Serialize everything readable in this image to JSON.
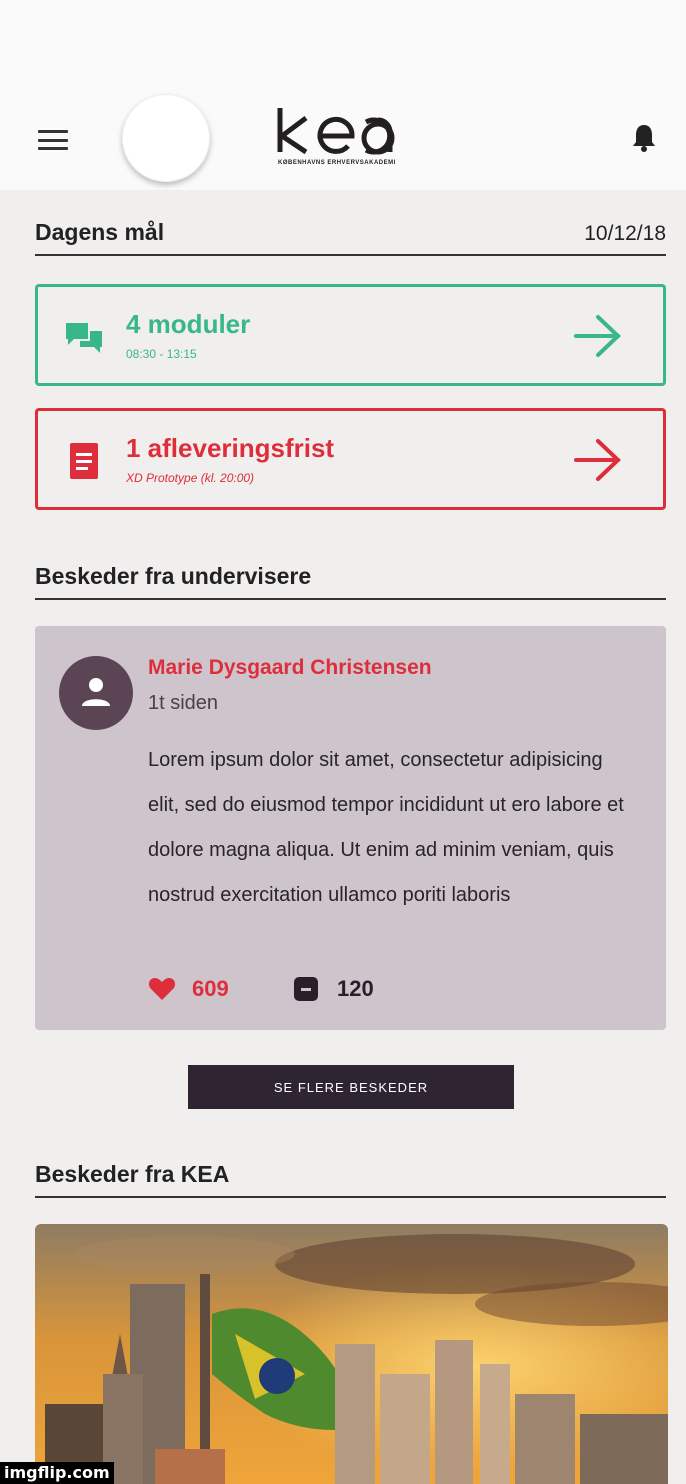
{
  "header": {
    "logo_text": "KEA",
    "logo_subtitle": "KØBENHAVNS ERHVERVSAKADEMI"
  },
  "goals": {
    "title": "Dagens mål",
    "date": "10/12/18"
  },
  "tasks": [
    {
      "title": "4 moduler",
      "subtitle": "08:30 - 13:15",
      "color": "#38b88a",
      "icon": "chat-icon"
    },
    {
      "title": "1 afleveringsfrist",
      "subtitle": "XD Prototype (kl. 20:00)",
      "color": "#de2e3c",
      "icon": "document-icon"
    }
  ],
  "teacher_messages": {
    "title": "Beskeder fra undervisere",
    "message": {
      "author": "Marie Dysgaard Christensen",
      "time": "1t siden",
      "body": "Lorem ipsum dolor sit amet, consectetur adipisicing elit, sed do eiusmod tempor incididunt ut ero labore et dolore magna aliqua. Ut enim ad minim veniam, quis nostrud exercitation ullamco poriti laboris",
      "likes": "609",
      "comments": "120"
    },
    "more_button": "SE FLERE BESKEDER"
  },
  "kea_messages": {
    "title": "Beskeder fra KEA"
  },
  "watermark": "imgflip.com",
  "colors": {
    "green": "#38b88a",
    "red": "#de2e3c",
    "dark": "#2f2431",
    "card_bg": "#cdc5cb"
  }
}
